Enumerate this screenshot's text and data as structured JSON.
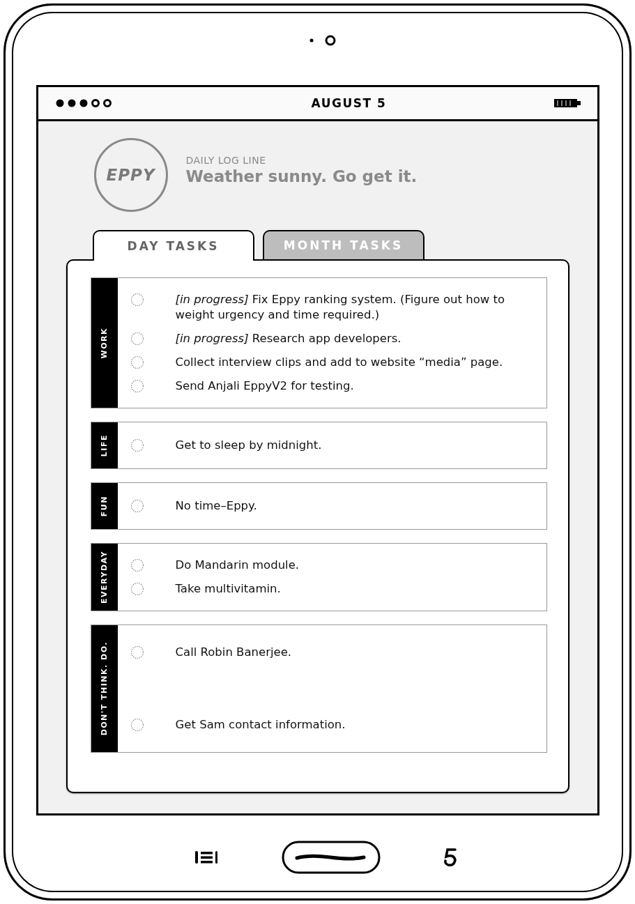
{
  "status_bar": {
    "date": "AUGUST 5"
  },
  "header": {
    "logo": "EPPY",
    "label": "DAILY LOG LINE",
    "message": "Weather sunny. Go get it."
  },
  "tabs": [
    {
      "label": "DAY TASKS",
      "selected": true
    },
    {
      "label": "MONTH TASKS",
      "selected": false
    }
  ],
  "groups": [
    {
      "name": "WORK",
      "tasks": [
        {
          "text": "*[in progress]* Fix Eppy ranking system. (Figure out how to weight urgency and time required.)",
          "checked": false
        },
        {
          "text": "*[in progress]* Research app developers.",
          "checked": false
        },
        {
          "text": "Collect interview clips and add to website “media” page.",
          "checked": false
        },
        {
          "text": "Send Anjali EppyV2 for testing.",
          "checked": false
        }
      ]
    },
    {
      "name": "LIFE",
      "tasks": [
        {
          "text": "Get to sleep by midnight.",
          "checked": false
        }
      ]
    },
    {
      "name": "FUN",
      "tasks": [
        {
          "text": "No time–Eppy.",
          "checked": false
        }
      ]
    },
    {
      "name": "EVERYDAY",
      "tasks": [
        {
          "text": "Do Mandarin module.",
          "checked": false
        },
        {
          "text": "Take multivitamin.",
          "checked": false
        }
      ]
    },
    {
      "name": "DON'T THINK. DO.",
      "tasks": [
        {
          "text": "Call Robin Banerjee.",
          "checked": false
        },
        {
          "text": "Get Sam contact information.",
          "checked": false
        }
      ]
    }
  ]
}
